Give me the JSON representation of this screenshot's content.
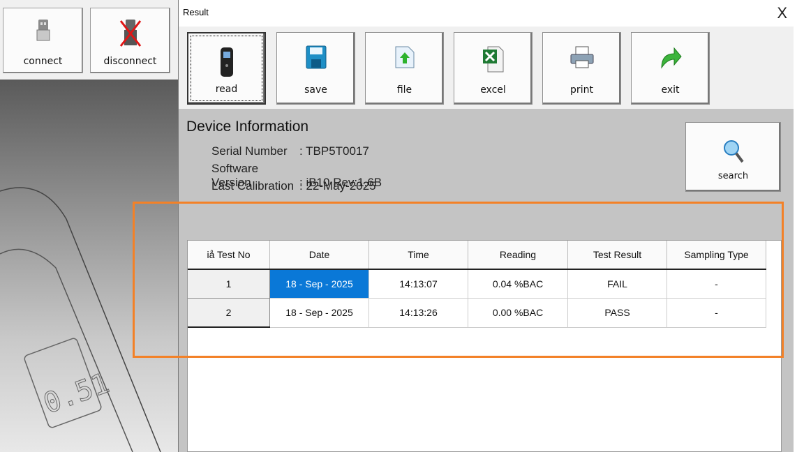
{
  "background_app": {
    "buttons": [
      {
        "label": "connect",
        "icon": "usb-icon"
      },
      {
        "label": "disconnect",
        "icon": "usb-disconnect-icon"
      }
    ],
    "device_display_text": "0.51"
  },
  "window": {
    "title": "Result",
    "close_label": "X",
    "toolbar": [
      {
        "label": "read",
        "icon": "breathalyzer-icon"
      },
      {
        "label": "save",
        "icon": "floppy-disk-icon"
      },
      {
        "label": "file",
        "icon": "file-upload-icon"
      },
      {
        "label": "excel",
        "icon": "excel-icon"
      },
      {
        "label": "print",
        "icon": "printer-icon"
      },
      {
        "label": "exit",
        "icon": "exit-arrow-icon"
      }
    ],
    "device_info": {
      "heading": "Device Information",
      "serial_label": "Serial Number",
      "serial_value": ": TBP5T0017",
      "software_label": "Software Version",
      "software_value": ": iB10  Rev:1.6B",
      "calibration_label": "Last Calibration",
      "calibration_value": ": 22-May-2025"
    },
    "search_label": "search",
    "table": {
      "headers": [
        "iå  Test No",
        "Date",
        "Time",
        "Reading",
        "Test Result",
        "Sampling Type"
      ],
      "rows": [
        [
          "1",
          "18 - Sep - 2025",
          "14:13:07",
          "0.04  %BAC",
          "FAIL",
          "-"
        ],
        [
          "2",
          "18 - Sep - 2025",
          "14:13:26",
          "0.00  %BAC",
          "PASS",
          "-"
        ]
      ]
    }
  },
  "colors": {
    "highlight": "#f38127",
    "selection": "#0a78d7",
    "window_bg": "#c4c4c4"
  }
}
